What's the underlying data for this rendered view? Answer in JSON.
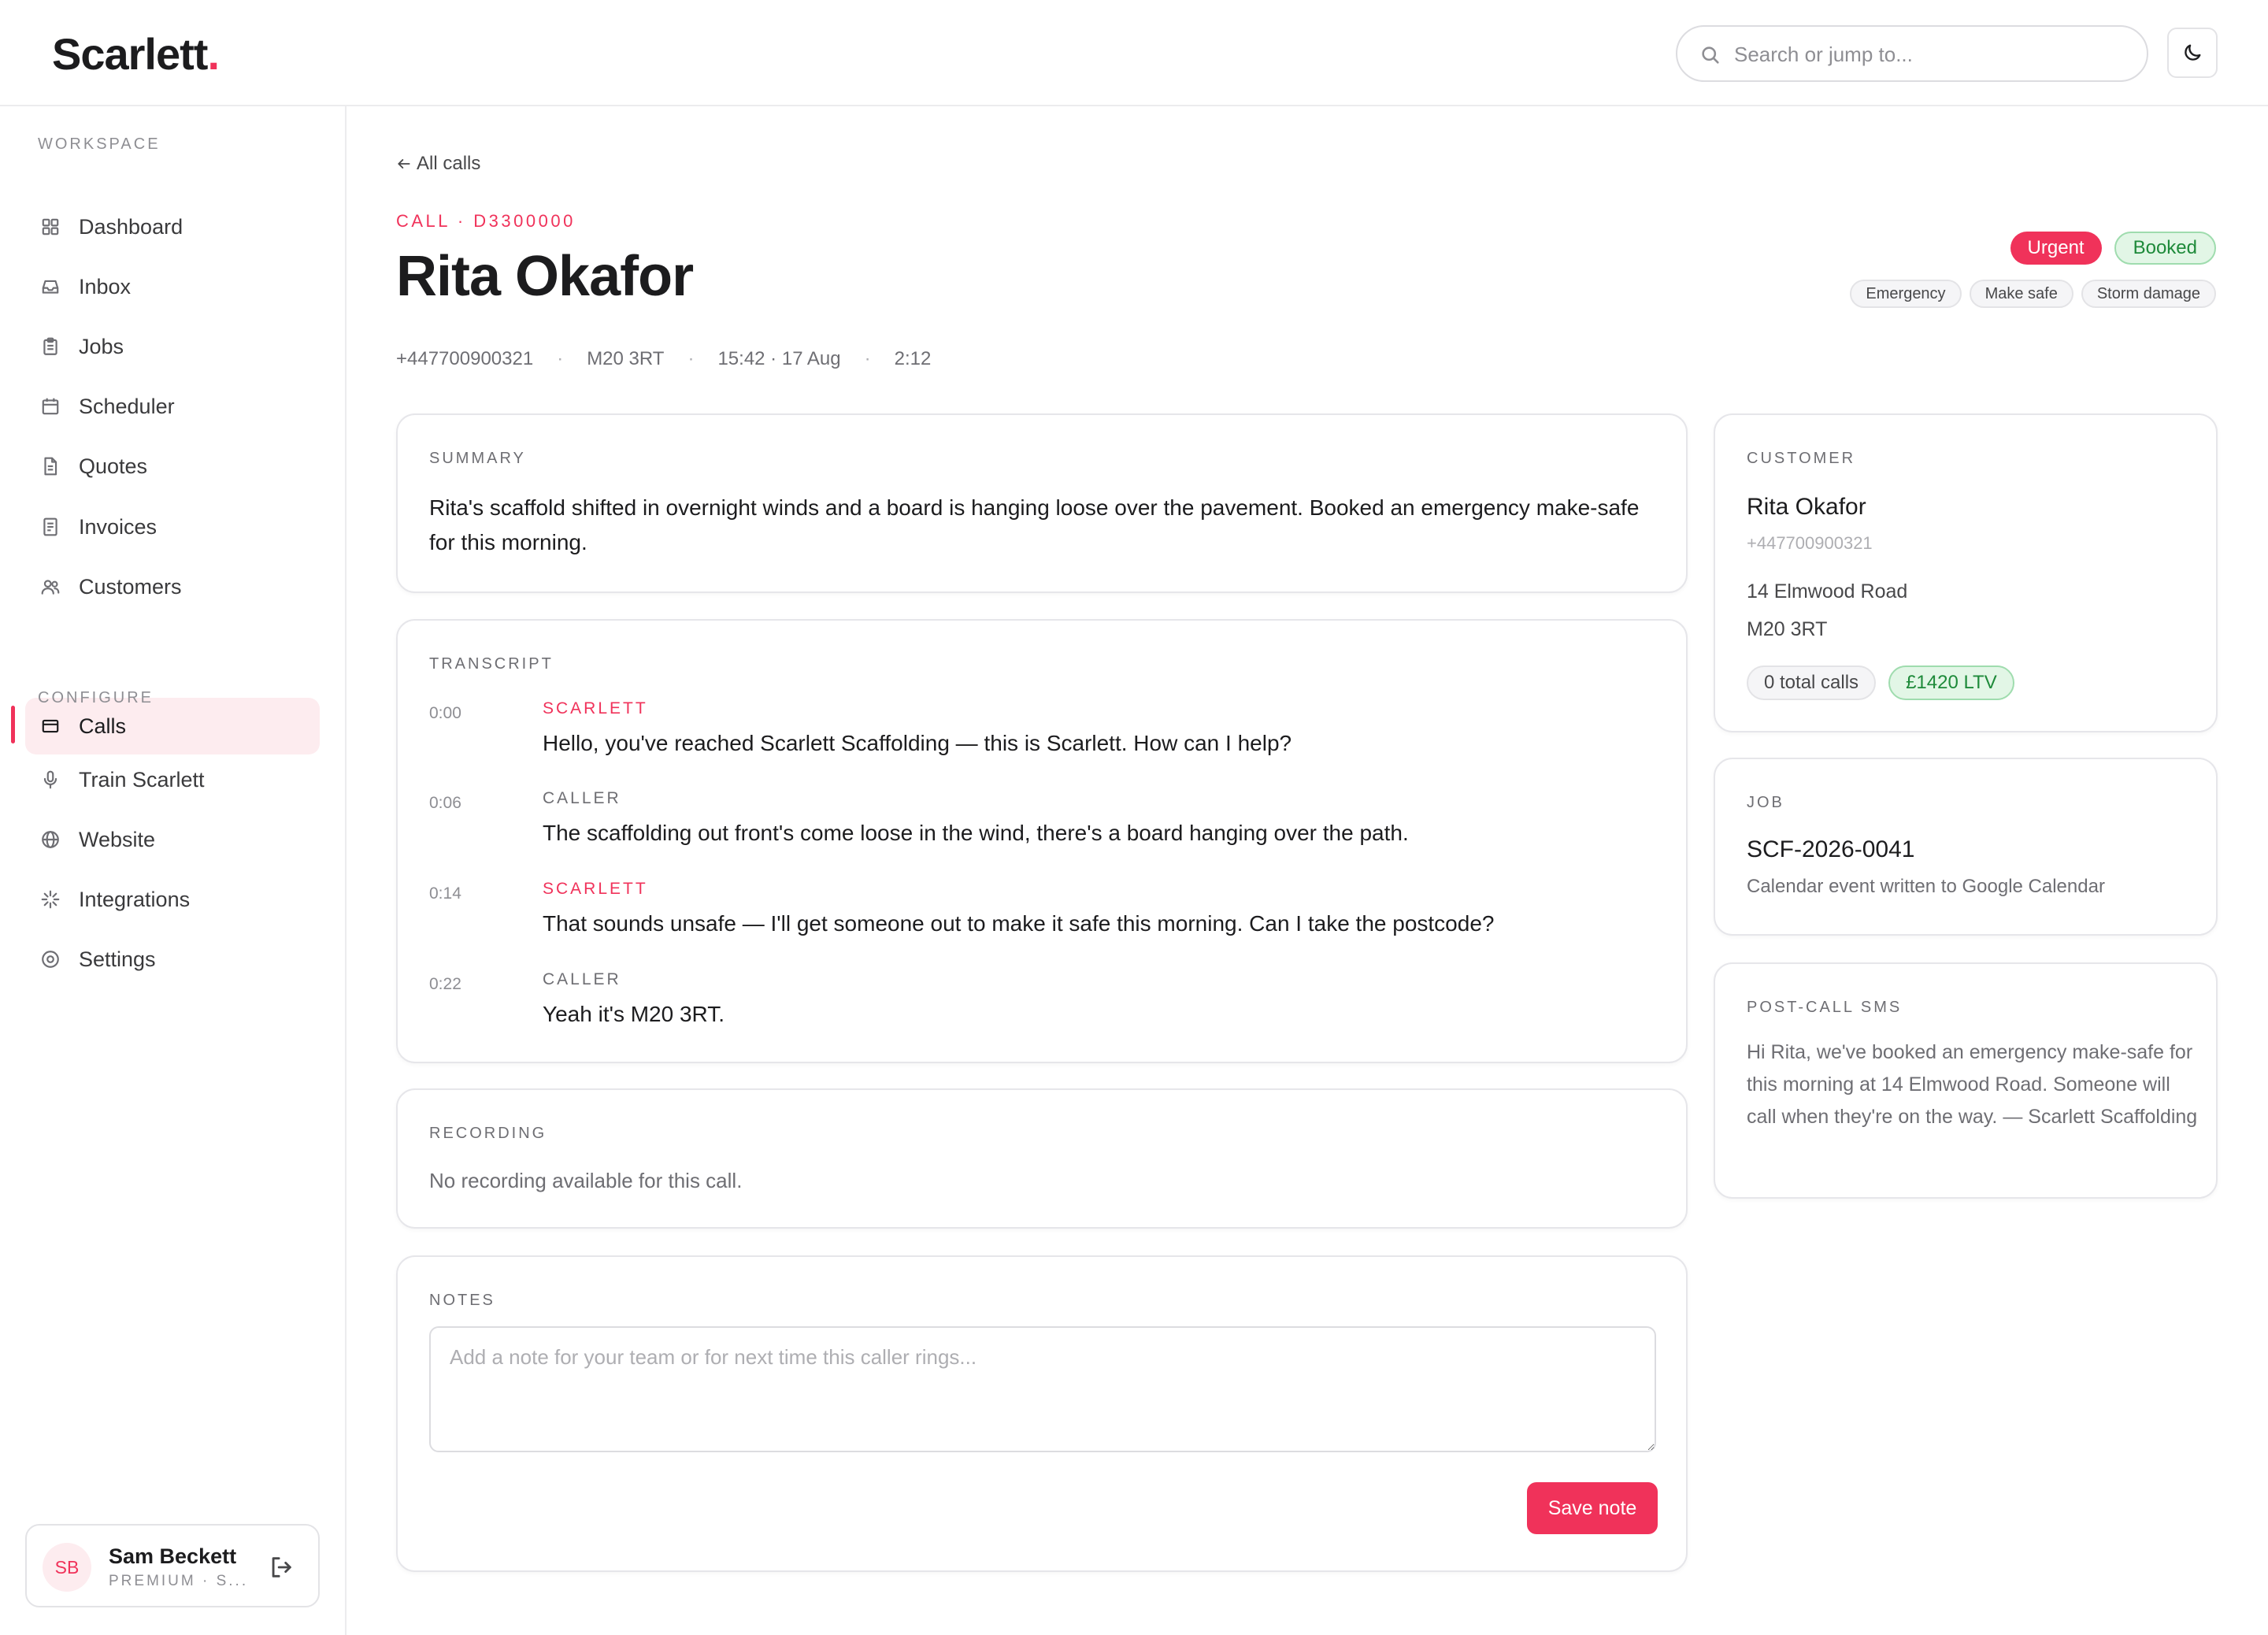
{
  "app": {
    "logo_text": "Scarlett",
    "logo_dot": ".",
    "accent": "#f0325a"
  },
  "search": {
    "placeholder": "Search or jump to..."
  },
  "sidebar": {
    "workspace_label": "WORKSPACE",
    "workspace_items": [
      {
        "label": "Dashboard",
        "icon": "grid-icon"
      },
      {
        "label": "Inbox",
        "icon": "inbox-icon"
      },
      {
        "label": "Jobs",
        "icon": "clipboard-icon"
      },
      {
        "label": "Scheduler",
        "icon": "calendar-icon"
      },
      {
        "label": "Quotes",
        "icon": "document-icon"
      },
      {
        "label": "Invoices",
        "icon": "receipt-icon"
      },
      {
        "label": "Customers",
        "icon": "users-icon"
      },
      {
        "label": "Calls",
        "icon": "card-icon",
        "active": true
      }
    ],
    "configure_label": "CONFIGURE",
    "configure_items": [
      {
        "label": "Train Scarlett",
        "icon": "microphone-icon"
      },
      {
        "label": "Website",
        "icon": "globe-icon"
      },
      {
        "label": "Integrations",
        "icon": "sparkle-icon"
      },
      {
        "label": "Settings",
        "icon": "settings-icon"
      }
    ],
    "user": {
      "initials": "SB",
      "name": "Sam Beckett",
      "plan": "PREMIUM · S..."
    }
  },
  "page": {
    "back_label": "All calls",
    "eyebrow": "CALL · D3300000",
    "title": "Rita Okafor",
    "meta": {
      "phone": "+447700900321",
      "postcode": "M20 3RT",
      "time": "15:42 · 17 Aug",
      "duration": "2:12",
      "separator": "·"
    },
    "status_badges": [
      "Urgent",
      "Booked"
    ],
    "tags": [
      "Emergency",
      "Make safe",
      "Storm damage"
    ]
  },
  "summary": {
    "label": "SUMMARY",
    "text": "Rita's scaffold shifted in overnight winds and a board is hanging loose over the pavement. Booked an emergency make-safe for this morning."
  },
  "transcript": {
    "label": "TRANSCRIPT",
    "lines": [
      {
        "time": "0:00",
        "speaker": "SCARLETT",
        "text": "Hello, you've reached Scarlett Scaffolding — this is Scarlett. How can I help?"
      },
      {
        "time": "0:06",
        "speaker": "CALLER",
        "text": "The scaffolding out front's come loose in the wind, there's a board hanging over the path."
      },
      {
        "time": "0:14",
        "speaker": "SCARLETT",
        "text": "That sounds unsafe — I'll get someone out to make it safe this morning. Can I take the postcode?"
      },
      {
        "time": "0:22",
        "speaker": "CALLER",
        "text": "Yeah it's M20 3RT."
      }
    ]
  },
  "recording": {
    "label": "RECORDING",
    "text": "No recording available for this call."
  },
  "notes": {
    "label": "NOTES",
    "placeholder": "Add a note for your team or for next time this caller rings...",
    "value": "",
    "save_label": "Save note"
  },
  "customer": {
    "label": "CUSTOMER",
    "name": "Rita Okafor",
    "phone": "+447700900321",
    "address_line1": "14 Elmwood Road",
    "address_line2": "M20 3RT",
    "total_calls": "0 total calls",
    "ltv": "£1420 LTV"
  },
  "job": {
    "label": "JOB",
    "reference": "SCF-2026-0041",
    "subtitle": "Calendar event written to Google Calendar"
  },
  "sms": {
    "label": "POST-CALL SMS",
    "text": "Hi Rita, we've booked an emergency make-safe for this morning at 14 Elmwood Road. Someone will call when they're on the way. — Scarlett Scaffolding"
  }
}
